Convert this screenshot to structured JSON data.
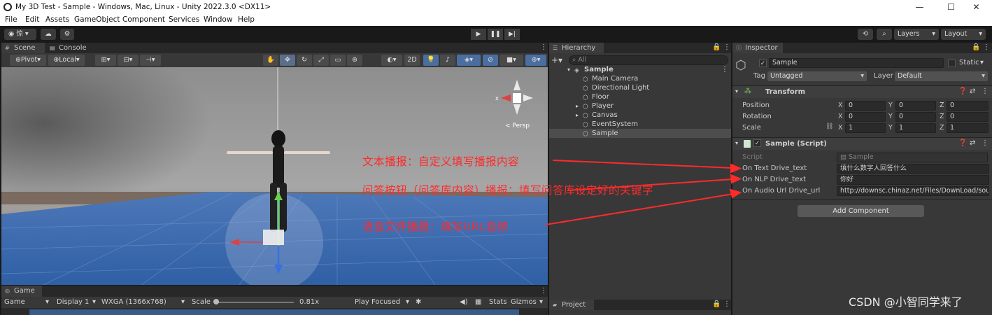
{
  "window": {
    "title": "My 3D Test - Sample - Windows, Mac, Linux - Unity 2022.3.0 <DX11>",
    "minimize": "—",
    "maximize": "☐",
    "close": "✕"
  },
  "menu": [
    "File",
    "Edit",
    "Assets",
    "GameObject",
    "Component",
    "Services",
    "Window",
    "Help"
  ],
  "toolbar": {
    "account_label": "惊",
    "layers_label": "Layers",
    "layout_label": "Layout"
  },
  "scene_panel": {
    "tabs": [
      "Scene",
      "Console"
    ],
    "pivot_label": "Pivot",
    "local_label": "Local",
    "mode_2d": "2D",
    "persp_label": "< Persp"
  },
  "game_panel": {
    "tab": "Game",
    "display_mode": "Game",
    "display": "Display 1",
    "resolution": "WXGA (1366x768)",
    "scale_label": "Scale",
    "scale_value": "0.81x",
    "play_focused": "Play Focused",
    "stats": "Stats",
    "gizmos": "Gizmos"
  },
  "hierarchy": {
    "tab": "Hierarchy",
    "search_placeholder": "All",
    "scene": "Sample",
    "items": [
      {
        "name": "Main Camera",
        "expandable": false
      },
      {
        "name": "Directional Light",
        "expandable": false
      },
      {
        "name": "Floor",
        "expandable": false
      },
      {
        "name": "Player",
        "expandable": true
      },
      {
        "name": "Canvas",
        "expandable": true
      },
      {
        "name": "EventSystem",
        "expandable": false
      },
      {
        "name": "Sample",
        "expandable": false,
        "selected": true
      }
    ]
  },
  "project": {
    "tab": "Project"
  },
  "inspector": {
    "tab": "Inspector",
    "object_name": "Sample",
    "static_label": "Static",
    "tag_label": "Tag",
    "tag_value": "Untagged",
    "layer_label": "Layer",
    "layer_value": "Default",
    "transform": {
      "title": "Transform",
      "rows": [
        {
          "label": "Position",
          "x": "0",
          "y": "0",
          "z": "0"
        },
        {
          "label": "Rotation",
          "x": "0",
          "y": "0",
          "z": "0"
        },
        {
          "label": "Scale",
          "x": "1",
          "y": "1",
          "z": "1"
        }
      ],
      "axis": [
        "X",
        "Y",
        "Z"
      ]
    },
    "script_component": {
      "title": "Sample (Script)",
      "script_label": "Script",
      "script_value": "Sample",
      "fields": [
        {
          "label": "On Text Drive_text",
          "value": "填什么数字人回答什么"
        },
        {
          "label": "On NLP Drive_text",
          "value": "你好"
        },
        {
          "label": "On Audio Url Drive_url",
          "value": "http://downsc.chinaz.net/Files/DownLoad/soun"
        }
      ]
    },
    "add_component": "Add Component"
  },
  "annotations": [
    "文本播报：自定义填写播报内容",
    "问答按钮（问答库内容）播报：填写问答库设定好的关键字",
    "语音文件播报：填写URL音频"
  ],
  "watermark": "CSDN @小智同学来了",
  "colors": {
    "annotation": "#ff2a2a",
    "selection": "#2c5d87",
    "panel": "#383838",
    "sky": "#6f6f6f",
    "ground": "#3d6bb0"
  }
}
